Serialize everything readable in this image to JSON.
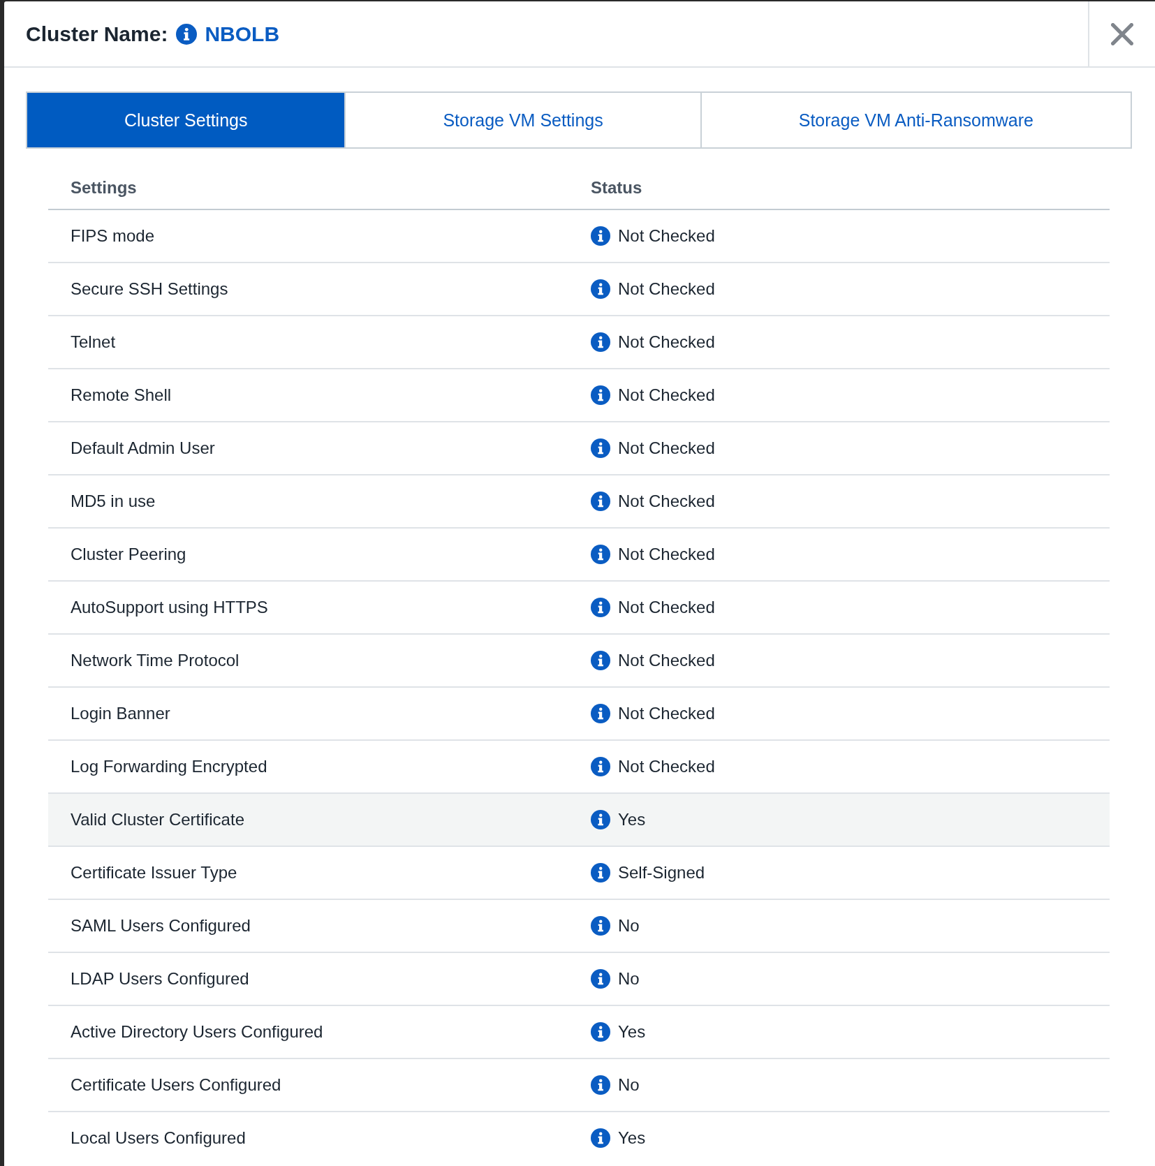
{
  "dialog": {
    "title_label": "Cluster Name:",
    "cluster_name": "NBOLB"
  },
  "tabs": [
    {
      "label": "Cluster Settings",
      "selected": true
    },
    {
      "label": "Storage VM Settings",
      "selected": false
    },
    {
      "label": "Storage VM Anti-Ransomware",
      "selected": false
    }
  ],
  "table": {
    "columns": [
      "Settings",
      "Status"
    ],
    "rows": [
      {
        "setting": "FIPS mode",
        "status": "Not Checked",
        "selected": false
      },
      {
        "setting": "Secure SSH Settings",
        "status": "Not Checked",
        "selected": false
      },
      {
        "setting": "Telnet",
        "status": "Not Checked",
        "selected": false
      },
      {
        "setting": "Remote Shell",
        "status": "Not Checked",
        "selected": false
      },
      {
        "setting": "Default Admin User",
        "status": "Not Checked",
        "selected": false
      },
      {
        "setting": "MD5 in use",
        "status": "Not Checked",
        "selected": false
      },
      {
        "setting": "Cluster Peering",
        "status": "Not Checked",
        "selected": false
      },
      {
        "setting": "AutoSupport using HTTPS",
        "status": "Not Checked",
        "selected": false
      },
      {
        "setting": "Network Time Protocol",
        "status": "Not Checked",
        "selected": false
      },
      {
        "setting": "Login Banner",
        "status": "Not Checked",
        "selected": false
      },
      {
        "setting": "Log Forwarding Encrypted",
        "status": "Not Checked",
        "selected": false
      },
      {
        "setting": "Valid Cluster Certificate",
        "status": "Yes",
        "selected": true
      },
      {
        "setting": "Certificate Issuer Type",
        "status": "Self-Signed",
        "selected": false
      },
      {
        "setting": "SAML Users Configured",
        "status": "No",
        "selected": false
      },
      {
        "setting": "LDAP Users Configured",
        "status": "No",
        "selected": false
      },
      {
        "setting": "Active Directory Users Configured",
        "status": "Yes",
        "selected": false
      },
      {
        "setting": "Certificate Users Configured",
        "status": "No",
        "selected": false
      },
      {
        "setting": "Local Users Configured",
        "status": "Yes",
        "selected": false
      }
    ]
  }
}
